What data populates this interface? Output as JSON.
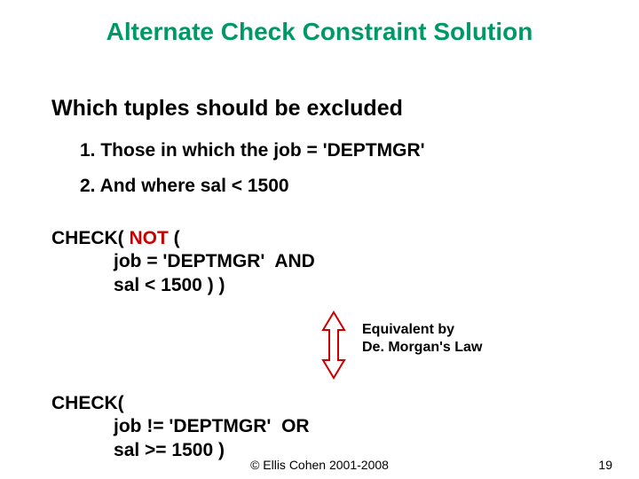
{
  "title": "Alternate Check Constraint Solution",
  "subheading": "Which tuples should be excluded",
  "points": {
    "p1": "1.  Those in which the job = 'DEPTMGR'",
    "p2": "2.  And where sal < 1500"
  },
  "code1": {
    "l1a": "CHECK( ",
    "l1b": "NOT",
    "l1c": " (",
    "l2": "            job = 'DEPTMGR'  AND",
    "l3": "            sal < 1500 ) )"
  },
  "equiv": {
    "l1": "Equivalent by",
    "l2": "De. Morgan's Law"
  },
  "code2": {
    "l1": "CHECK(",
    "l2": "            job != 'DEPTMGR'  OR",
    "l3": "            sal >= 1500 )"
  },
  "footer": {
    "copyright": "© Ellis Cohen 2001-2008",
    "page": "19"
  },
  "colors": {
    "title": "#009966",
    "not": "#cc0000",
    "arrow_fill": "#ffffff",
    "arrow_stroke": "#cc0000"
  }
}
